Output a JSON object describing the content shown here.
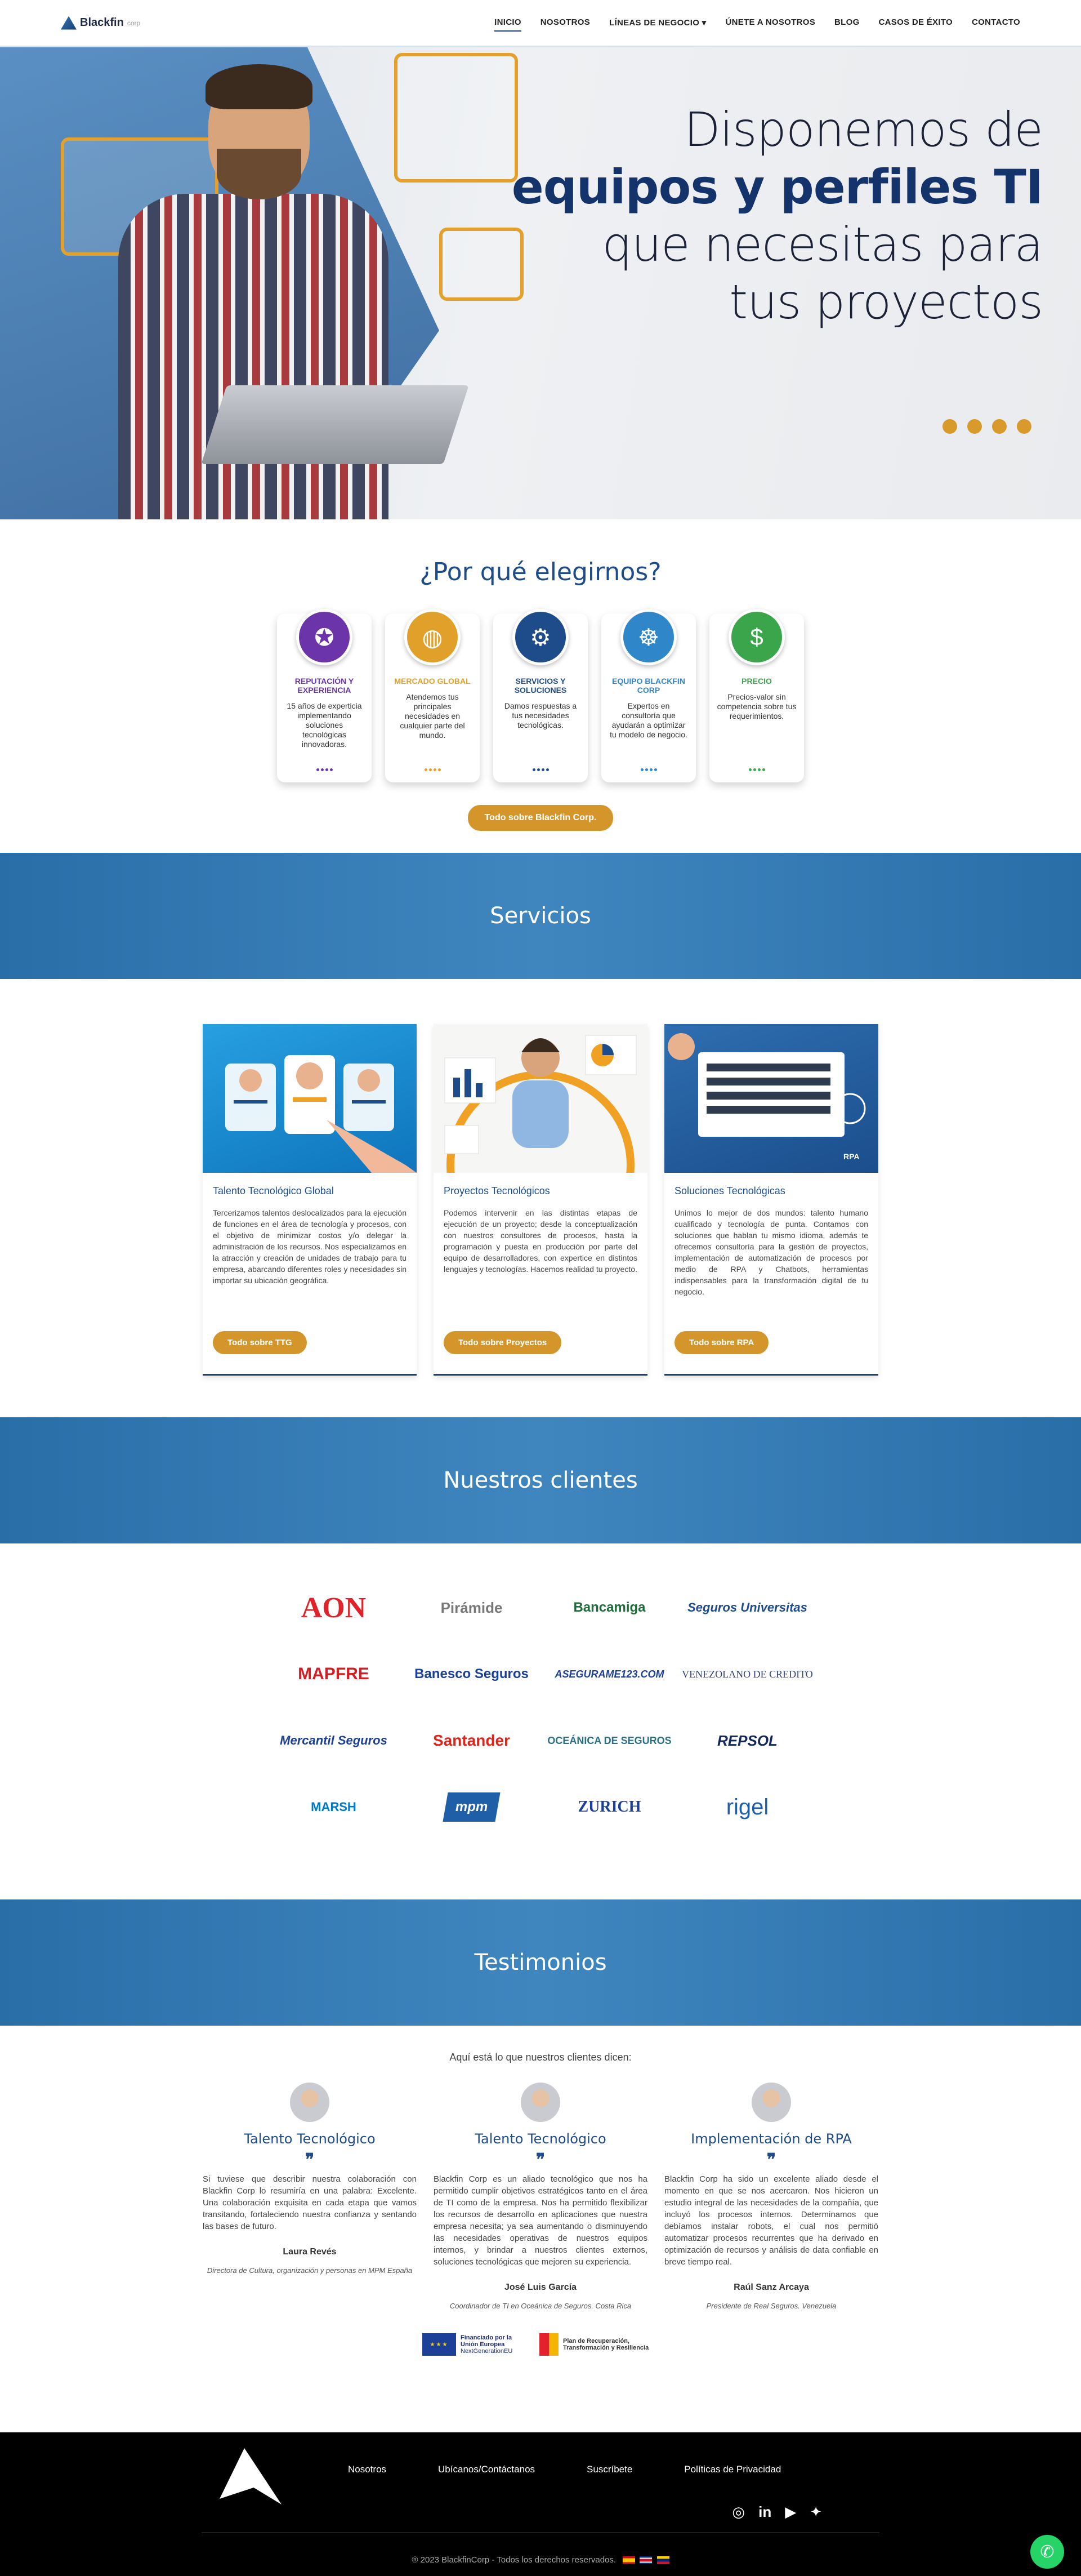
{
  "brand": {
    "name": "Blackfin",
    "suffix": "corp"
  },
  "nav": {
    "items": [
      "INICIO",
      "NOSOTROS",
      "LÍNEAS DE NEGOCIO",
      "ÚNETE A NOSOTROS",
      "BLOG",
      "CASOS DE ÉXITO",
      "CONTACTO"
    ],
    "active": "INICIO",
    "dropdown_icon": "chevron-down-icon"
  },
  "hero": {
    "line1": "Disponemos de",
    "line2": "equipos y perfiles TI",
    "line3": "que necesitas para",
    "line4": "tus proyectos",
    "slide_count": 4
  },
  "why": {
    "title": "¿Por qué elegirnos?",
    "cards": [
      {
        "title": "REPUTACIÓN Y EXPERIENCIA",
        "text": "15 años de experticia implementando soluciones tecnológicas innovadoras.",
        "color": "#6b34a8",
        "icon": "award-icon"
      },
      {
        "title": "MERCADO GLOBAL",
        "text": "Atendemos tus principales necesidades en cualquier parte del mundo.",
        "color": "#e0a02a",
        "icon": "globe-icon"
      },
      {
        "title": "SERVICIOS Y SOLUCIONES",
        "text": "Damos respuestas a tus necesidades tecnológicas.",
        "color": "#1e4c8a",
        "icon": "solutions-icon"
      },
      {
        "title": "EQUIPO BLACKFIN CORP",
        "text": "Expertos en consultoría que ayudarán a optimizar tu modelo de negocio.",
        "color": "#2f86c8",
        "icon": "team-icon"
      },
      {
        "title": "PRECIO",
        "text": "Precios-valor sin competencia sobre tus requerimientos.",
        "color": "#3aa54a",
        "icon": "price-icon"
      }
    ],
    "button": "Todo sobre Blackfin Corp."
  },
  "services": {
    "title": "Servicios",
    "cards": [
      {
        "title": "Talento Tecnológico Global",
        "text": "Tercerizamos talentos deslocalizados para la ejecución de funciones en el área de tecnología y procesos, con el objetivo de minimizar costos y/o delegar la administración de los recursos. Nos especializamos en la atracción y creación de unidades de trabajo para tu empresa, abarcando diferentes roles y necesidades sin importar su ubicación geográfica.",
        "button": "Todo sobre TTG"
      },
      {
        "title": "Proyectos Tecnológicos",
        "text": "Podemos intervenir en las distintas etapas de ejecución de un proyecto; desde la conceptualización con nuestros consultores de procesos, hasta la programación y puesta en producción por parte del equipo de desarrolladores, con expertice en distintos lenguajes y tecnologías. Hacemos realidad tu proyecto.",
        "button": "Todo sobre Proyectos"
      },
      {
        "title": "Soluciones Tecnológicas",
        "text": "Unimos lo mejor de dos mundos: talento humano cualificado y tecnología de punta. Contamos con soluciones que hablan tu mismo idioma, además te ofrecemos consultoría para la gestión de proyectos, implementación de automatización de procesos por medio de RPA y Chatbots, herramientas indispensables para la transformación digital de tu negocio.",
        "button": "Todo sobre RPA"
      }
    ],
    "rpa_label": "RPA"
  },
  "clients": {
    "title": "Nuestros clientes",
    "logos": [
      {
        "text": "AON",
        "color": "#e0232a"
      },
      {
        "text": "Pirámide",
        "color": "#777777"
      },
      {
        "text": "Bancamiga",
        "color": "#1f6b3b"
      },
      {
        "text": "Seguros Universitas",
        "color": "#1e4c8a"
      },
      {
        "text": "MAPFRE",
        "color": "#d11f26"
      },
      {
        "text": "Banesco Seguros",
        "color": "#1c3f98"
      },
      {
        "text": "ASEGURAME123.COM",
        "color": "#1c3f98"
      },
      {
        "text": "VENEZOLANO DE CREDITO",
        "color": "#33437a"
      },
      {
        "text": "Mercantil Seguros",
        "color": "#1c3f98"
      },
      {
        "text": "Santander",
        "color": "#e2231a"
      },
      {
        "text": "OCEÁNICA DE SEGUROS",
        "color": "#2a6f8a"
      },
      {
        "text": "REPSOL",
        "color": "#13275a"
      },
      {
        "text": "MARSH",
        "color": "#0078c8"
      },
      {
        "text": "mpm",
        "color": "#1e5fa8"
      },
      {
        "text": "ZURICH",
        "color": "#1c3f98"
      },
      {
        "text": "rigel",
        "color": "#1e5fa8"
      }
    ]
  },
  "testimonials": {
    "title": "Testimonios",
    "intro": "Aquí está lo que nuestros clientes dicen:",
    "items": [
      {
        "title": "Talento Tecnológico",
        "text": "Si tuviese que describir nuestra colaboración con Blackfin Corp lo resumiría en una palabra: Excelente. Una colaboración exquisita en cada etapa que vamos transitando, fortaleciendo nuestra confianza y sentando las bases de futuro.",
        "name": "Laura Revés",
        "role": "Directora de Cultura, organización y personas en MPM España"
      },
      {
        "title": "Talento Tecnológico",
        "text": "Blackfin Corp es un aliado tecnológico que nos ha permitido cumplir objetivos estratégicos tanto en el área de TI como de la empresa. Nos ha permitido flexibilizar los recursos de desarrollo en aplicaciones que nuestra empresa necesita; ya sea aumentando o disminuyendo las necesidades operativas de nuestros equipos internos, y brindar a nuestros clientes externos, soluciones tecnológicas que mejoren su experiencia.",
        "name": "José Luis García",
        "role": "Coordinador de TI en Oceánica de Seguros. Costa Rica"
      },
      {
        "title": "Implementación de RPA",
        "text": "Blackfin Corp ha sido un excelente aliado desde el momento en que se nos acercaron. Nos hicieron un estudio integral de las necesidades de la compañía, que incluyó los procesos internos. Determinamos que debíamos instalar robots, el cual nos permitió automatizar procesos recurrentes que ha derivado en optimización de recursos y análisis de data confiable en breve tiempo real.",
        "name": "Raúl Sanz Arcaya",
        "role": "Presidente de Real Seguros. Venezuela"
      }
    ],
    "funding": {
      "eu": "Financiado por la Unión Europea",
      "eu_sub": "NextGenerationEU",
      "plan": "Plan de Recuperación, Transformación y Resiliencia"
    }
  },
  "footer": {
    "links": [
      "Nosotros",
      "Ubícanos/Contáctanos",
      "Suscríbete",
      "Políticas de Privacidad"
    ],
    "copyright": "® 2023 BlackfinCorp - Todos los derechos reservados."
  }
}
